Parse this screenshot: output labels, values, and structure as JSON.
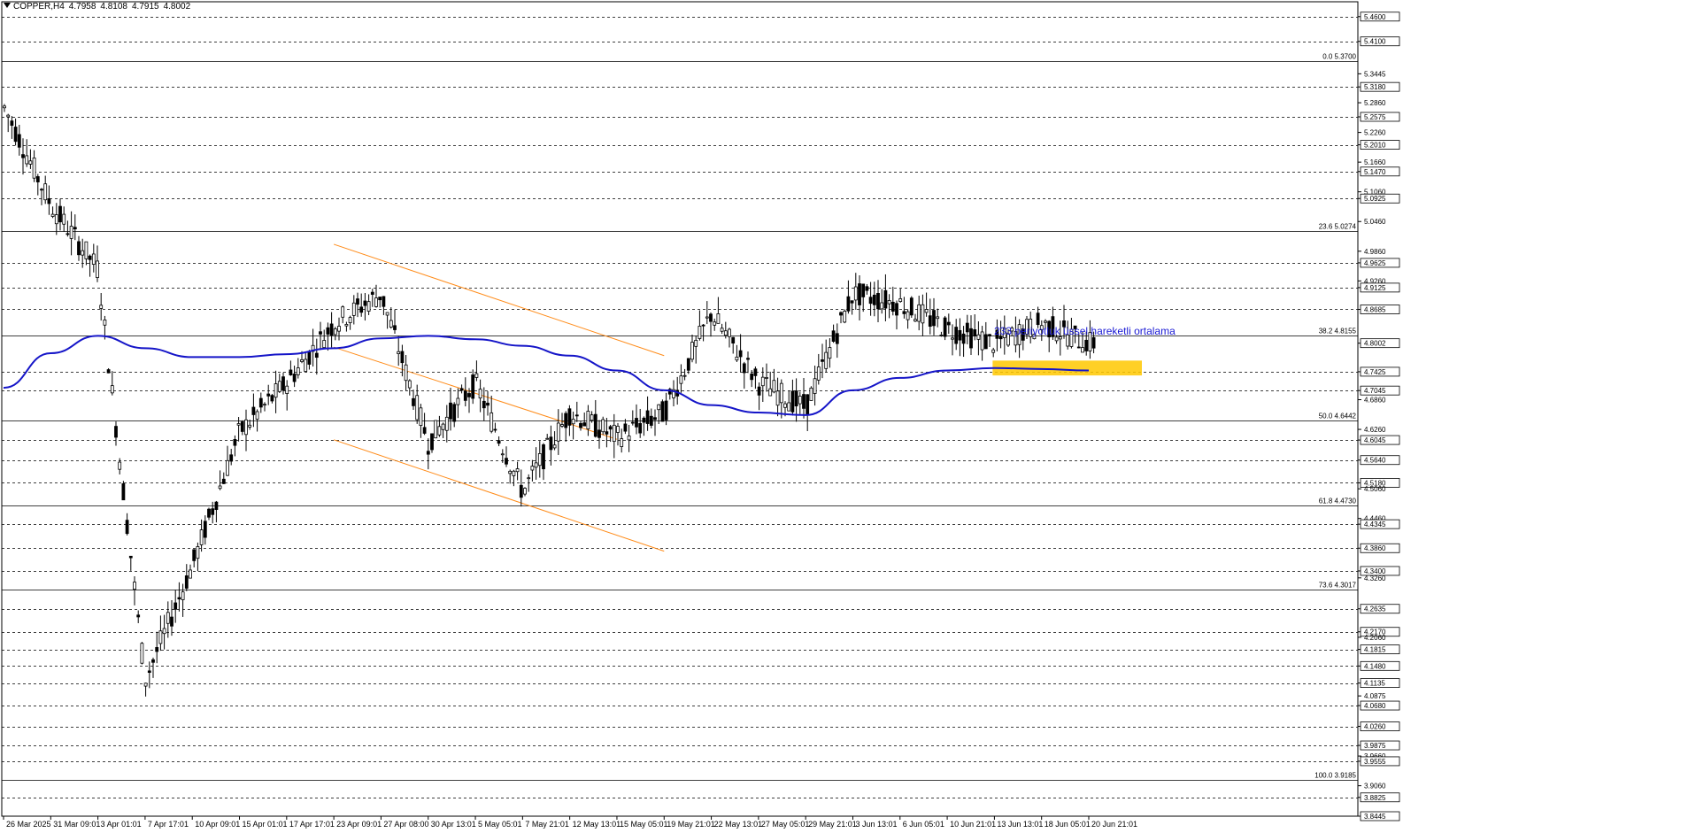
{
  "header": {
    "symbol_tf": "COPPER,H4",
    "open": "4.7958",
    "high": "4.8108",
    "low": "4.7915",
    "close": "4.8002"
  },
  "colors": {
    "background": "#ffffff",
    "candle": "#000000",
    "ema": "#1515c8",
    "channel": "#ff8c1a",
    "support_zone": "#ffc800",
    "annotation_text": "#1a1ad4",
    "grid_dashed": "#000000",
    "fib_line": "#000000"
  },
  "price_axis_labels": [
    {
      "value": 5.46,
      "text": "5.4600",
      "boxed": true
    },
    {
      "value": 5.41,
      "text": "5.4100",
      "boxed": true
    },
    {
      "value": 5.3445,
      "text": "5.3445",
      "boxed": false
    },
    {
      "value": 5.318,
      "text": "5.3180",
      "boxed": true
    },
    {
      "value": 5.286,
      "text": "5.2860",
      "boxed": false
    },
    {
      "value": 5.2575,
      "text": "5.2575",
      "boxed": true
    },
    {
      "value": 5.226,
      "text": "5.2260",
      "boxed": false
    },
    {
      "value": 5.201,
      "text": "5.2010",
      "boxed": true
    },
    {
      "value": 5.166,
      "text": "5.1660",
      "boxed": false
    },
    {
      "value": 5.147,
      "text": "5.1470",
      "boxed": true
    },
    {
      "value": 5.106,
      "text": "5.1060",
      "boxed": false
    },
    {
      "value": 5.0925,
      "text": "5.0925",
      "boxed": true
    },
    {
      "value": 5.046,
      "text": "5.0460",
      "boxed": false
    },
    {
      "value": 4.986,
      "text": "4.9860",
      "boxed": false
    },
    {
      "value": 4.9625,
      "text": "4.9625",
      "boxed": true
    },
    {
      "value": 4.926,
      "text": "4.9260",
      "boxed": false
    },
    {
      "value": 4.9125,
      "text": "4.9125",
      "boxed": true
    },
    {
      "value": 4.8685,
      "text": "4.8685",
      "boxed": true
    },
    {
      "value": 4.8002,
      "text": "4.8002",
      "boxed": true
    },
    {
      "value": 4.7425,
      "text": "4.7425",
      "boxed": true
    },
    {
      "value": 4.7045,
      "text": "4.7045",
      "boxed": true
    },
    {
      "value": 4.686,
      "text": "4.6860",
      "boxed": false
    },
    {
      "value": 4.626,
      "text": "4.6260",
      "boxed": false
    },
    {
      "value": 4.6045,
      "text": "4.6045",
      "boxed": true
    },
    {
      "value": 4.564,
      "text": "4.5640",
      "boxed": true
    },
    {
      "value": 4.518,
      "text": "4.5180",
      "boxed": true
    },
    {
      "value": 4.506,
      "text": "4.5060",
      "boxed": false
    },
    {
      "value": 4.446,
      "text": "4.4460",
      "boxed": false
    },
    {
      "value": 4.4345,
      "text": "4.4345",
      "boxed": true
    },
    {
      "value": 4.386,
      "text": "4.3860",
      "boxed": true
    },
    {
      "value": 4.34,
      "text": "4.3400",
      "boxed": true
    },
    {
      "value": 4.326,
      "text": "4.3260",
      "boxed": false
    },
    {
      "value": 4.2635,
      "text": "4.2635",
      "boxed": true
    },
    {
      "value": 4.217,
      "text": "4.2170",
      "boxed": true
    },
    {
      "value": 4.206,
      "text": "4.2060",
      "boxed": false
    },
    {
      "value": 4.1815,
      "text": "4.1815",
      "boxed": true
    },
    {
      "value": 4.148,
      "text": "4.1480",
      "boxed": true
    },
    {
      "value": 4.1135,
      "text": "4.1135",
      "boxed": true
    },
    {
      "value": 4.0875,
      "text": "4.0875",
      "boxed": false
    },
    {
      "value": 4.068,
      "text": "4.0680",
      "boxed": true
    },
    {
      "value": 4.026,
      "text": "4.0260",
      "boxed": true
    },
    {
      "value": 3.9875,
      "text": "3.9875",
      "boxed": true
    },
    {
      "value": 3.966,
      "text": "3.9660",
      "boxed": false
    },
    {
      "value": 3.9555,
      "text": "3.9555",
      "boxed": true
    },
    {
      "value": 3.906,
      "text": "3.9060",
      "boxed": false
    },
    {
      "value": 3.8825,
      "text": "3.8825",
      "boxed": true
    },
    {
      "value": 3.8445,
      "text": "3.8445",
      "boxed": true
    }
  ],
  "dashed_levels": [
    5.46,
    5.41,
    5.318,
    5.2575,
    5.201,
    5.147,
    5.0925,
    4.9625,
    4.9125,
    4.8685,
    4.7425,
    4.7045,
    4.6045,
    4.564,
    4.518,
    4.4345,
    4.386,
    4.34,
    4.2635,
    4.217,
    4.1815,
    4.148,
    4.1135,
    4.068,
    4.026,
    3.9875,
    3.9555,
    3.8825
  ],
  "fibonacci_levels": [
    {
      "value": 5.37,
      "label": "0.0 5.3700"
    },
    {
      "value": 5.0274,
      "label": "23.6 5.0274"
    },
    {
      "value": 4.8155,
      "label": "38.2 4.8155"
    },
    {
      "value": 4.6442,
      "label": "50.0 4.6442"
    },
    {
      "value": 4.473,
      "label": "61.8 4.4730"
    },
    {
      "value": 4.3017,
      "label": "73.6 4.3017"
    },
    {
      "value": 3.9185,
      "label": "100.0 3.9185"
    }
  ],
  "time_axis_labels": [
    "26 Mar 2025",
    "31 Mar 09:01",
    "3 Apr 01:01",
    "7 Apr 17:01",
    "10 Apr 09:01",
    "15 Apr 01:01",
    "17 Apr 17:01",
    "23 Apr 09:01",
    "27 Apr 08:00",
    "30 Apr 13:01",
    "5 May 05:01",
    "7 May 21:01",
    "12 May 13:01",
    "15 May 05:01",
    "19 May 21:01",
    "22 May 13:01",
    "27 May 05:01",
    "29 May 21:01",
    "3 Jun 13:01",
    "6 Jun 05:01",
    "10 Jun 21:01",
    "13 Jun 13:01",
    "18 Jun 05:01",
    "20 Jun 21:01"
  ],
  "annotation": {
    "text": "233 periyotluk üssel hareketli ortalama"
  },
  "chart_data": {
    "type": "candlestick",
    "title": "COPPER,H4",
    "ylim": [
      3.8445,
      5.49
    ],
    "ema_233": [
      {
        "x": "26 Mar 2025",
        "y": 4.71
      },
      {
        "x": "31 Mar 09:01",
        "y": 4.78
      },
      {
        "x": "3 Apr 01:01",
        "y": 4.815
      },
      {
        "x": "7 Apr 17:01",
        "y": 4.79
      },
      {
        "x": "10 Apr 09:01",
        "y": 4.772
      },
      {
        "x": "15 Apr 01:01",
        "y": 4.772
      },
      {
        "x": "17 Apr 17:01",
        "y": 4.778
      },
      {
        "x": "23 Apr 09:01",
        "y": 4.79
      },
      {
        "x": "27 Apr 08:00",
        "y": 4.81
      },
      {
        "x": "30 Apr 13:01",
        "y": 4.815
      },
      {
        "x": "5 May 05:01",
        "y": 4.808
      },
      {
        "x": "7 May 21:01",
        "y": 4.795
      },
      {
        "x": "12 May 13:01",
        "y": 4.775
      },
      {
        "x": "15 May 05:01",
        "y": 4.745
      },
      {
        "x": "19 May 21:01",
        "y": 4.705
      },
      {
        "x": "22 May 13:01",
        "y": 4.675
      },
      {
        "x": "27 May 05:01",
        "y": 4.66
      },
      {
        "x": "29 May 21:01",
        "y": 4.655
      },
      {
        "x": "3 Jun 13:01",
        "y": 4.705
      },
      {
        "x": "6 Jun 05:01",
        "y": 4.73
      },
      {
        "x": "10 Jun 21:01",
        "y": 4.745
      },
      {
        "x": "13 Jun 13:01",
        "y": 4.75
      },
      {
        "x": "18 Jun 05:01",
        "y": 4.748
      },
      {
        "x": "20 Jun 21:01",
        "y": 4.745
      }
    ],
    "price_path": [
      {
        "x": "26 Mar 2025",
        "y": 5.28
      },
      {
        "x": "31 Mar 09:01",
        "y": 5.08
      },
      {
        "x": "3 Apr 01:01",
        "y": 4.95
      },
      {
        "x": "7 Apr 17:01",
        "y": 4.12
      },
      {
        "x": "10 Apr 09:01",
        "y": 4.35
      },
      {
        "x": "15 Apr 01:01",
        "y": 4.62
      },
      {
        "x": "17 Apr 17:01",
        "y": 4.72
      },
      {
        "x": "23 Apr 09:01",
        "y": 4.84
      },
      {
        "x": "27 Apr 08:00",
        "y": 4.9
      },
      {
        "x": "30 Apr 13:01",
        "y": 4.6
      },
      {
        "x": "5 May 05:01",
        "y": 4.72
      },
      {
        "x": "7 May 21:01",
        "y": 4.5
      },
      {
        "x": "12 May 13:01",
        "y": 4.66
      },
      {
        "x": "15 May 05:01",
        "y": 4.61
      },
      {
        "x": "19 May 21:01",
        "y": 4.66
      },
      {
        "x": "22 May 13:01",
        "y": 4.86
      },
      {
        "x": "27 May 05:01",
        "y": 4.72
      },
      {
        "x": "29 May 21:01",
        "y": 4.67
      },
      {
        "x": "3 Jun 13:01",
        "y": 4.9
      },
      {
        "x": "6 Jun 05:01",
        "y": 4.88
      },
      {
        "x": "10 Jun 21:01",
        "y": 4.83
      },
      {
        "x": "13 Jun 13:01",
        "y": 4.8
      },
      {
        "x": "18 Jun 05:01",
        "y": 4.84
      },
      {
        "x": "20 Jun 21:01",
        "y": 4.8
      }
    ],
    "channel": {
      "upper": [
        {
          "x": "23 Apr 09:01",
          "y": 5.0
        },
        {
          "x": "19 May 21:01",
          "y": 4.775
        }
      ],
      "middle": [
        {
          "x": "23 Apr 09:01",
          "y": 4.792
        },
        {
          "x": "15 May 05:01",
          "y": 4.606
        }
      ],
      "lower": [
        {
          "x": "23 Apr 09:01",
          "y": 4.605
        },
        {
          "x": "19 May 21:01",
          "y": 4.38
        }
      ]
    },
    "support_zone": {
      "x_start": "13 Jun 13:01",
      "price_top": 4.765,
      "price_bottom": 4.735
    }
  }
}
